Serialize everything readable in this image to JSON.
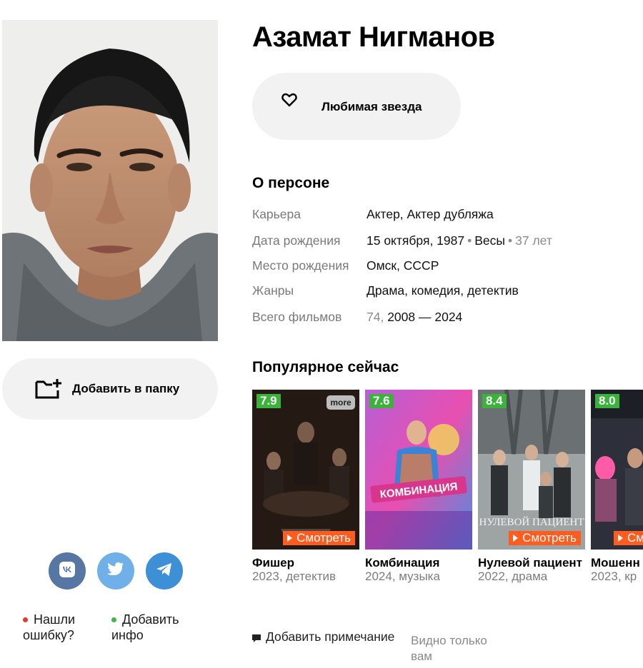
{
  "person": {
    "name": "Азамат Нигманов",
    "favorite_label": "Любимая звезда",
    "add_folder_label": "Добавить в папку"
  },
  "about": {
    "title": "О персоне",
    "rows": [
      {
        "key": "Карьера",
        "value": "Актер, Актер дубляжа"
      },
      {
        "key": "Дата рождения",
        "value_main": "15 октября, 1987",
        "value_sign": "Весы",
        "value_age": "37 лет"
      },
      {
        "key": "Место рождения",
        "value": "Омск, СССР"
      },
      {
        "key": "Жанры",
        "value": "Драма, комедия, детектив"
      },
      {
        "key": "Всего фильмов",
        "value_count": "74,",
        "value_years": "2008 — 2024"
      }
    ]
  },
  "popular": {
    "title": "Популярное сейчас",
    "watch_label": "Смотреть",
    "films": [
      {
        "rating": "7.9",
        "title": "Фишер",
        "sub": "2023, детектив",
        "badge": "more"
      },
      {
        "rating": "7.6",
        "title": "Комбинация",
        "sub": "2024, музыка",
        "poster_text": "КОМБИНАЦИЯ"
      },
      {
        "rating": "8.4",
        "title": "Нулевой пациент",
        "sub": "2022, драма",
        "poster_text": "НУЛЕВОЙ ПАЦИЕНТ"
      },
      {
        "rating": "8.0",
        "title": "Мошенн",
        "sub": "2023, кр"
      }
    ]
  },
  "social": {
    "items": [
      {
        "name": "vk-icon",
        "color": "#5677a3"
      },
      {
        "name": "twitter-icon",
        "color": "#6fb0e8"
      },
      {
        "name": "telegram-icon",
        "color": "#3d8fd6"
      }
    ]
  },
  "footer": {
    "error_label": "Нашли ошибку?",
    "error_dot_color": "#e53935",
    "add_info_label": "Добавить инфо",
    "add_info_dot_color": "#43b649",
    "note_label": "Добавить примечание",
    "note_visibility": "Видно только вам"
  },
  "colors": {
    "rating_bg": "#3bb33b",
    "watch_bg": "#ff5c1f",
    "button_bg": "#f2f2f2"
  }
}
